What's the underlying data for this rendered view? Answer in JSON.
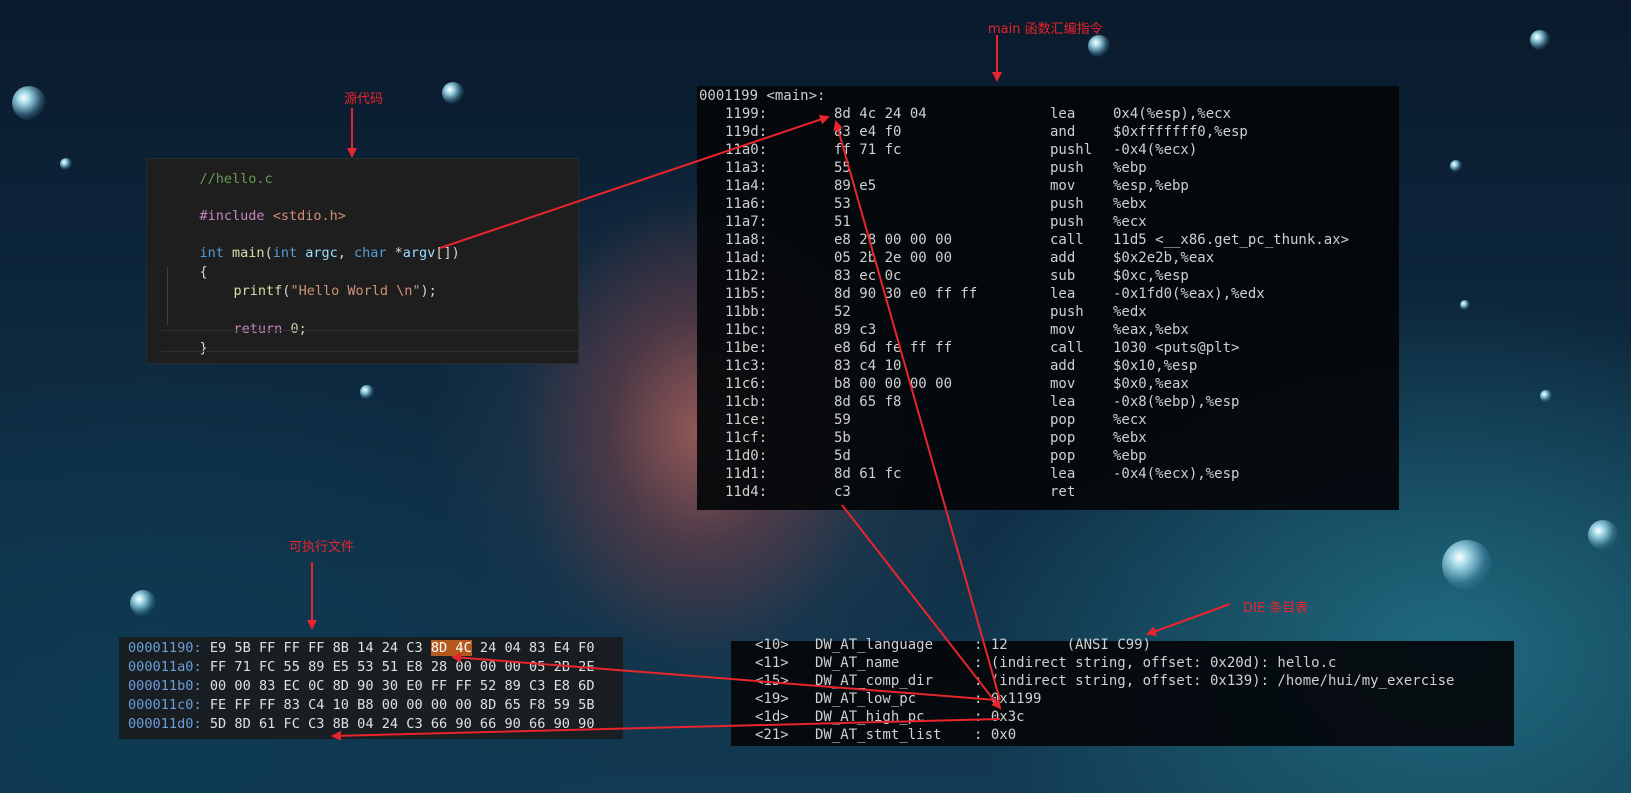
{
  "annotations": {
    "source": "源代码",
    "disasm": "main 函数汇编指令",
    "executable": "可执行文件",
    "die": "DIE 条目表"
  },
  "colors": {
    "annotation": "#e8252c",
    "hex_highlight": "#b45a1e",
    "addr": "#6a9ed8"
  },
  "source_code": {
    "comment": "//hello.c",
    "include_directive": "#include",
    "include_header": "<stdio.h>",
    "sig_type": "int",
    "sig_name": "main",
    "sig_open": "(",
    "sig_arg1_type": "int",
    "sig_arg1": "argc",
    "sig_comma": ", ",
    "sig_arg2_type": "char",
    "sig_star": " *",
    "sig_arg2": "argv",
    "sig_close": "[])",
    "open_brace": "{",
    "printf_fn": "printf",
    "printf_open": "(",
    "printf_str": "\"Hello World \\n\"",
    "printf_close": ");",
    "return_kw": "return",
    "return_val": "0",
    "return_semi": ";",
    "close_brace": "}"
  },
  "disassembly": {
    "header": "0001199 <main>:",
    "rows": [
      {
        "addr": "1199:",
        "bytes": "8d 4c 24 04",
        "op": "lea",
        "args": "0x4(%esp),%ecx"
      },
      {
        "addr": "119d:",
        "bytes": "83 e4 f0",
        "op": "and",
        "args": "$0xfffffff0,%esp"
      },
      {
        "addr": "11a0:",
        "bytes": "ff 71 fc",
        "op": "pushl",
        "args": "-0x4(%ecx)"
      },
      {
        "addr": "11a3:",
        "bytes": "55",
        "op": "push",
        "args": "%ebp"
      },
      {
        "addr": "11a4:",
        "bytes": "89 e5",
        "op": "mov",
        "args": "%esp,%ebp"
      },
      {
        "addr": "11a6:",
        "bytes": "53",
        "op": "push",
        "args": "%ebx"
      },
      {
        "addr": "11a7:",
        "bytes": "51",
        "op": "push",
        "args": "%ecx"
      },
      {
        "addr": "11a8:",
        "bytes": "e8 28 00 00 00",
        "op": "call",
        "args": "11d5 <__x86.get_pc_thunk.ax>"
      },
      {
        "addr": "11ad:",
        "bytes": "05 2b 2e 00 00",
        "op": "add",
        "args": "$0x2e2b,%eax"
      },
      {
        "addr": "11b2:",
        "bytes": "83 ec 0c",
        "op": "sub",
        "args": "$0xc,%esp"
      },
      {
        "addr": "11b5:",
        "bytes": "8d 90 30 e0 ff ff",
        "op": "lea",
        "args": "-0x1fd0(%eax),%edx"
      },
      {
        "addr": "11bb:",
        "bytes": "52",
        "op": "push",
        "args": "%edx"
      },
      {
        "addr": "11bc:",
        "bytes": "89 c3",
        "op": "mov",
        "args": "%eax,%ebx"
      },
      {
        "addr": "11be:",
        "bytes": "e8 6d fe ff ff",
        "op": "call",
        "args": "1030 <puts@plt>"
      },
      {
        "addr": "11c3:",
        "bytes": "83 c4 10",
        "op": "add",
        "args": "$0x10,%esp"
      },
      {
        "addr": "11c6:",
        "bytes": "b8 00 00 00 00",
        "op": "mov",
        "args": "$0x0,%eax"
      },
      {
        "addr": "11cb:",
        "bytes": "8d 65 f8",
        "op": "lea",
        "args": "-0x8(%ebp),%esp"
      },
      {
        "addr": "11ce:",
        "bytes": "59",
        "op": "pop",
        "args": "%ecx"
      },
      {
        "addr": "11cf:",
        "bytes": "5b",
        "op": "pop",
        "args": "%ebx"
      },
      {
        "addr": "11d0:",
        "bytes": "5d",
        "op": "pop",
        "args": "%ebp"
      },
      {
        "addr": "11d1:",
        "bytes": "8d 61 fc",
        "op": "lea",
        "args": "-0x4(%ecx),%esp"
      },
      {
        "addr": "11d4:",
        "bytes": "c3",
        "op": "ret",
        "args": ""
      }
    ]
  },
  "hexdump": {
    "rows": [
      {
        "addr": "00001190:",
        "pre": " E9 5B FF FF FF 8B 14 24 C3 ",
        "hl": "8D 4C",
        "post": " 24 04 83 E4 F0"
      },
      {
        "addr": "000011a0:",
        "pre": " FF 71 FC 55 89 E5 53 51 E8 28 00 00 00 05 2B 2E",
        "hl": "",
        "post": ""
      },
      {
        "addr": "000011b0:",
        "pre": " 00 00 83 EC 0C 8D 90 30 E0 FF FF 52 89 C3 E8 6D",
        "hl": "",
        "post": ""
      },
      {
        "addr": "000011c0:",
        "pre": " FE FF FF 83 C4 10 B8 00 00 00 00 8D 65 F8 59 5B",
        "hl": "",
        "post": ""
      },
      {
        "addr": "000011d0:",
        "pre": " 5D 8D 61 FC C3 8B 04 24 C3 66 90 66 90 66 90 90",
        "hl": "",
        "post": ""
      }
    ]
  },
  "die_table": {
    "rows": [
      {
        "off": "<10>",
        "attr": "DW_AT_language",
        "val": ": 12       (ANSI C99)"
      },
      {
        "off": "<11>",
        "attr": "DW_AT_name",
        "val": ": (indirect string, offset: 0x20d): hello.c"
      },
      {
        "off": "<15>",
        "attr": "DW_AT_comp_dir",
        "val": ": (indirect string, offset: 0x139): /home/hui/my_exercise"
      },
      {
        "off": "<19>",
        "attr": "DW_AT_low_pc",
        "val": ": 0x1199"
      },
      {
        "off": "<1d>",
        "attr": "DW_AT_high_pc",
        "val": ": 0x3c"
      },
      {
        "off": "<21>",
        "attr": "DW_AT_stmt_list",
        "val": ": 0x0"
      }
    ]
  }
}
